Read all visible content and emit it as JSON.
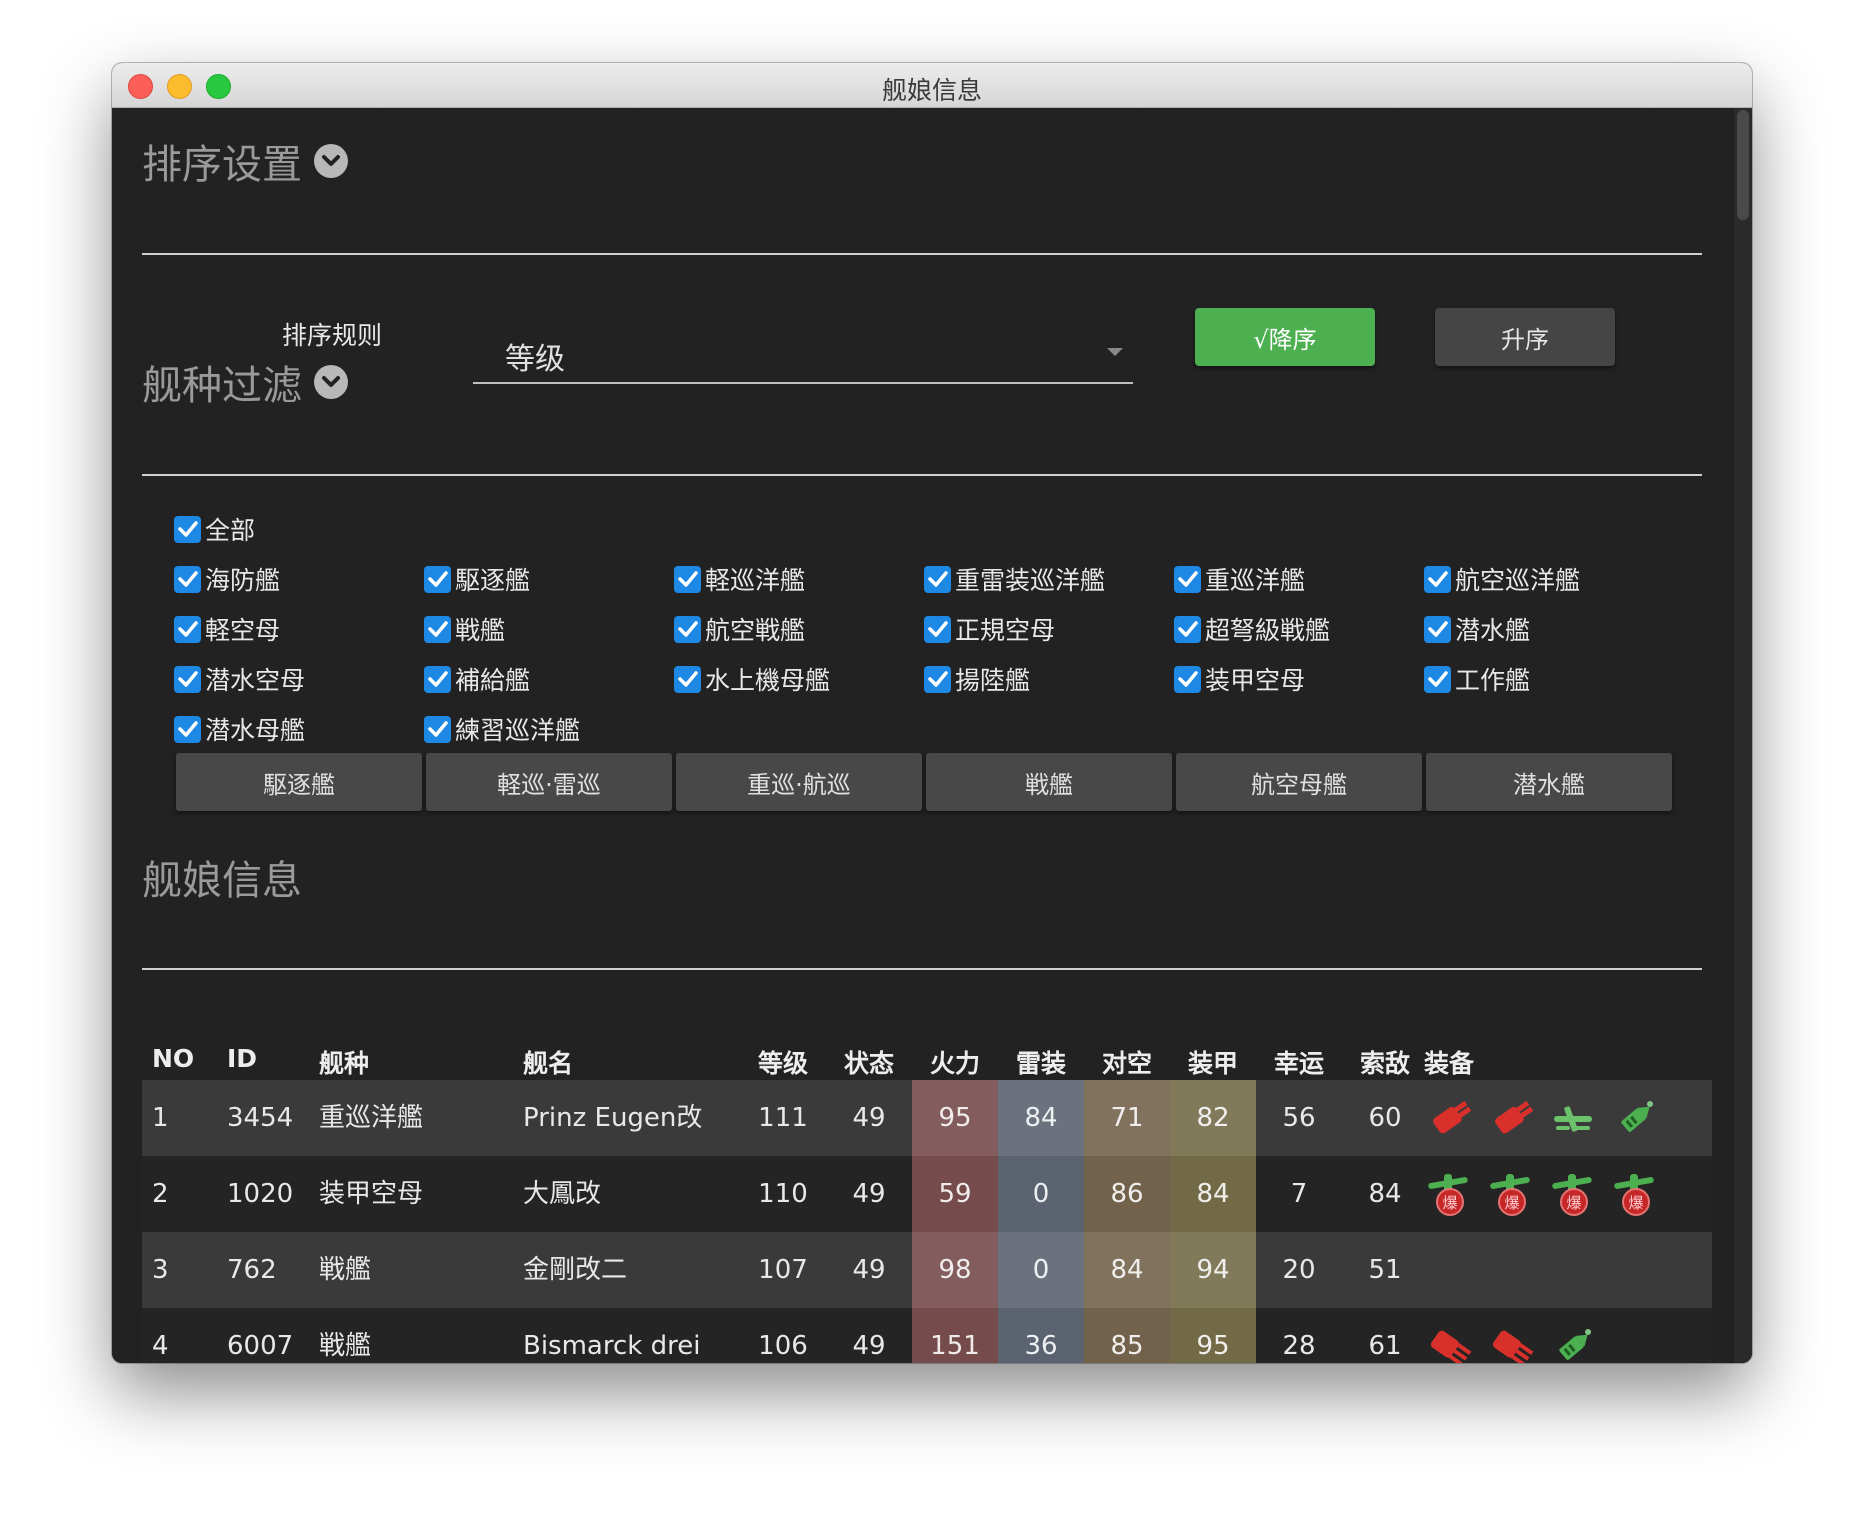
{
  "window": {
    "title": "舰娘信息"
  },
  "sort": {
    "title": "排序设置",
    "rule_label": "排序规则",
    "rule_value": "等级",
    "desc_label": "√降序",
    "asc_label": "升序"
  },
  "filter": {
    "title": "舰种过滤",
    "all_label": "全部",
    "types": [
      "海防艦",
      "駆逐艦",
      "軽巡洋艦",
      "重雷装巡洋艦",
      "重巡洋艦",
      "航空巡洋艦",
      "軽空母",
      "戦艦",
      "航空戦艦",
      "正規空母",
      "超弩級戦艦",
      "潜水艦",
      "潜水空母",
      "補給艦",
      "水上機母艦",
      "揚陸艦",
      "装甲空母",
      "工作艦",
      "潜水母艦",
      "練習巡洋艦"
    ],
    "category_buttons": [
      "駆逐艦",
      "軽巡·雷巡",
      "重巡·航巡",
      "戦艦",
      "航空母艦",
      "潜水艦"
    ]
  },
  "info": {
    "title": "舰娘信息",
    "columns": [
      "NO",
      "ID",
      "舰种",
      "舰名",
      "等级",
      "状态",
      "火力",
      "雷装",
      "对空",
      "装甲",
      "幸运",
      "索敌",
      "装备"
    ],
    "rows": [
      {
        "no": "1",
        "id": "3454",
        "type": "重巡洋艦",
        "name": "Prinz Eugen改",
        "level": "111",
        "cond": "49",
        "fire": "95",
        "torpedo": "84",
        "aa": "71",
        "armor": "82",
        "luck": "56",
        "los": "60",
        "equip": [
          "red-gun-icon",
          "red-gun-icon",
          "green-seaplane-icon",
          "green-ammo-icon"
        ]
      },
      {
        "no": "2",
        "id": "1020",
        "type": "装甲空母",
        "name": "大鳳改",
        "level": "110",
        "cond": "49",
        "fire": "59",
        "torpedo": "0",
        "aa": "86",
        "armor": "84",
        "luck": "7",
        "los": "84",
        "equip": [
          "green-bomber-icon",
          "green-bomber-icon",
          "green-bomber-icon",
          "green-bomber-icon"
        ]
      },
      {
        "no": "3",
        "id": "762",
        "type": "戦艦",
        "name": "金剛改二",
        "level": "107",
        "cond": "49",
        "fire": "98",
        "torpedo": "0",
        "aa": "84",
        "armor": "94",
        "luck": "20",
        "los": "51",
        "equip": []
      },
      {
        "no": "4",
        "id": "6007",
        "type": "戦艦",
        "name": "Bismarck drei",
        "level": "106",
        "cond": "49",
        "fire": "151",
        "torpedo": "36",
        "aa": "85",
        "armor": "95",
        "luck": "28",
        "los": "61",
        "equip": [
          "red-heavy-gun-icon",
          "red-heavy-gun-icon",
          "green-ammo-icon"
        ]
      }
    ],
    "bomber_label": "爆"
  },
  "colors": {
    "checkbox": "#1e88e5",
    "desc_button": "#4caf50",
    "fire_col": "#6e3535",
    "torpedo_col": "#4a5566",
    "aa_col": "#6b5434",
    "armor_col": "#6b6030"
  }
}
